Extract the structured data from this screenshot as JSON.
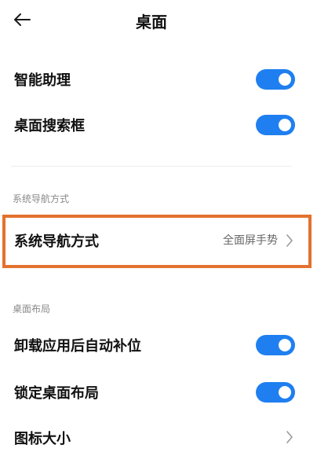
{
  "header": {
    "back_icon": "arrow-left-icon",
    "title": "桌面"
  },
  "settings": {
    "smart_assistant": {
      "label": "智能助理",
      "enabled": true
    },
    "desktop_search": {
      "label": "桌面搜索框",
      "enabled": true
    }
  },
  "navigation_section": {
    "header": "系统导航方式",
    "item": {
      "label": "系统导航方式",
      "value": "全面屏手势",
      "chevron_icon": "chevron-right-icon"
    }
  },
  "layout_section": {
    "header": "桌面布局",
    "auto_fill": {
      "label": "卸载应用后自动补位",
      "enabled": true
    },
    "lock_layout": {
      "label": "锁定桌面布局",
      "enabled": true
    },
    "icon_size": {
      "label": "图标大小",
      "chevron_icon": "chevron-right-icon"
    }
  },
  "colors": {
    "accent": "#1f7ff0",
    "highlight_border": "#e4712f",
    "section_header": "#8a8a8a",
    "value_text": "#666666"
  }
}
